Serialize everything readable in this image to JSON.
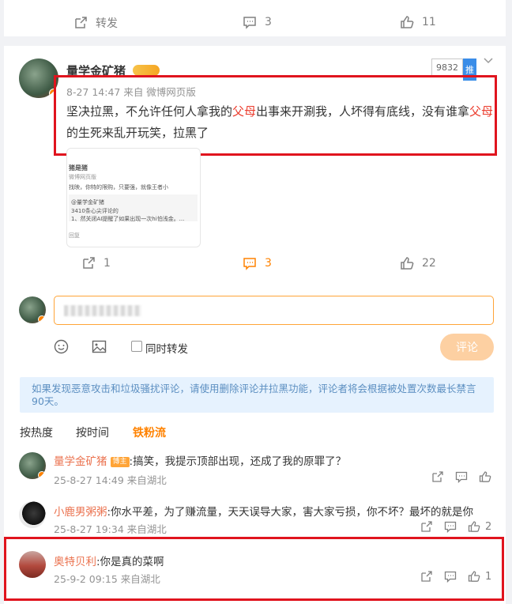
{
  "top_actions": {
    "forward": "转发",
    "comments": "3",
    "likes": "11"
  },
  "post": {
    "username": "量学金矿猪",
    "meta": "8-27 14:47  来自 微博网页版",
    "text_parts": [
      "坚决拉黑，不允许任何人拿我的",
      "父母",
      "出事来开涮我，人坏得有底线，没有谁拿",
      "父母",
      "的生死来乱开玩笑，拉黑了"
    ],
    "rank_number": "9832",
    "rank_tag": "推",
    "thumb_lines": [
      "猪是猪",
      "微博网页版",
      "找映，你特的限购，只要强，就像王者小",
      "@量学金矿猪",
      "3410条心尖评论的",
      "1、然关闭AI提醒了如果出现一次hi怕浅金。...",
      "回复"
    ],
    "actions": {
      "forward": "1",
      "comments": "3",
      "likes": "22"
    }
  },
  "composer": {
    "repost_label": "同时转发",
    "submit_label": "评论"
  },
  "notice": "如果发现恶意攻击和垃圾骚扰评论，请使用删除评论并拉黑功能，评论者将会根据被处置次数最长禁言90天。",
  "sort_tabs": [
    "按热度",
    "按时间",
    "铁粉流"
  ],
  "comments": [
    {
      "name": "量学金矿猪",
      "badge": "博主",
      "text": ":搞笑，我提示顶部出现，还成了我的原罪了？",
      "meta": "25-8-27 14:49  来自湖北",
      "likes": ""
    },
    {
      "name": "小鹿男粥粥",
      "badge": "",
      "text": ":你水平差，为了赚流量，天天误导大家，害大家亏损，你不坏？最坏的就是你",
      "meta": "25-8-27 19:34  来自湖北",
      "likes": "2"
    },
    {
      "name": "奥特贝利",
      "badge": "",
      "text": ":你是真的菜啊",
      "meta": "25-9-2 09:15  来自湖北",
      "likes": "1"
    }
  ],
  "colors": {
    "accent": "#ff8200",
    "highlight_box": "#e0141e",
    "name_link": "#eb7350"
  }
}
